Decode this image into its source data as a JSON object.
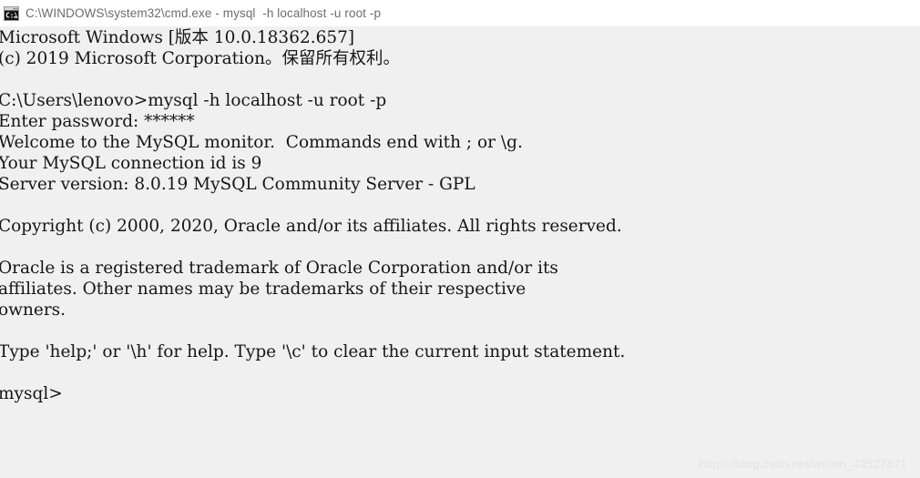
{
  "window": {
    "icon": "cmd-console-icon",
    "title": "C:\\WINDOWS\\system32\\cmd.exe - mysql  -h localhost -u root -p",
    "titlebar_bg": "#ffffff",
    "titlebar_text_color": "#6d6d6d"
  },
  "terminal": {
    "background": "#f0f0f0",
    "text_color": "#161616",
    "lines": [
      "Microsoft Windows [版本 10.0.18362.657]",
      "(c) 2019 Microsoft Corporation。保留所有权利。",
      "",
      "C:\\Users\\lenovo>mysql -h localhost -u root -p",
      "Enter password: ******",
      "Welcome to the MySQL monitor.  Commands end with ; or \\g.",
      "Your MySQL connection id is 9",
      "Server version: 8.0.19 MySQL Community Server - GPL",
      "",
      "Copyright (c) 2000, 2020, Oracle and/or its affiliates. All rights reserved.",
      "",
      "Oracle is a registered trademark of Oracle Corporation and/or its",
      "affiliates. Other names may be trademarks of their respective",
      "owners.",
      "",
      "Type 'help;' or '\\h' for help. Type '\\c' to clear the current input statement.",
      "",
      "mysql>"
    ]
  },
  "watermark": {
    "text": "https://blog.csdn.net/weixin_43527871",
    "color": "#e3e3e3"
  }
}
